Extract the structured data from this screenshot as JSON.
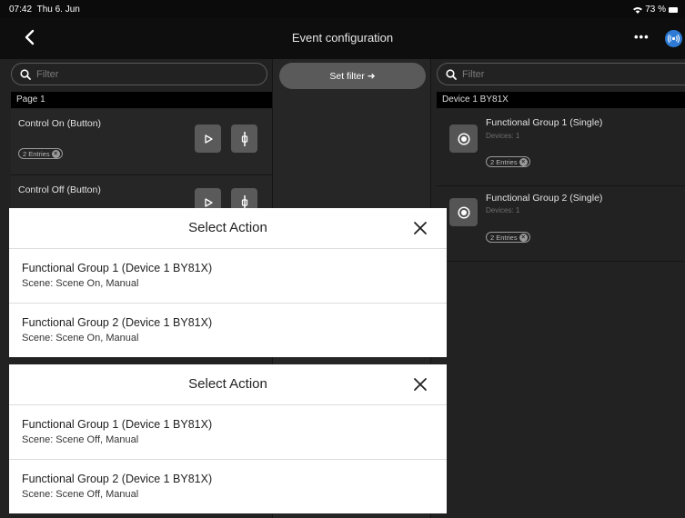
{
  "status": {
    "time": "07:42",
    "date": "Thu 6. Jun",
    "battery": "73 %"
  },
  "nav": {
    "title": "Event configuration",
    "more_label": "•••"
  },
  "left": {
    "filter_placeholder": "Filter",
    "section": "Page 1",
    "events": [
      {
        "title": "Control On (Button)",
        "badge": "2 Entries"
      },
      {
        "title": "Control Off (Button)"
      }
    ]
  },
  "middle": {
    "set_filter_label": "Set filter ➜"
  },
  "right": {
    "filter_placeholder": "Filter",
    "section": "Device 1 BY81X",
    "groups": [
      {
        "title": "Functional Group 1 (Single)",
        "devices": "Devices: 1",
        "badge": "2 Entries"
      },
      {
        "title": "Functional Group 2 (Single)",
        "devices": "Devices: 1",
        "badge": "2 Entries"
      }
    ]
  },
  "modals": [
    {
      "title": "Select Action",
      "items": [
        {
          "title": "Functional Group 1 (Device 1 BY81X)",
          "subtitle": "Scene: Scene On, Manual"
        },
        {
          "title": "Functional Group 2 (Device 1 BY81X)",
          "subtitle": "Scene: Scene On, Manual"
        }
      ]
    },
    {
      "title": "Select Action",
      "items": [
        {
          "title": "Functional Group 1 (Device 1 BY81X)",
          "subtitle": "Scene: Scene Off, Manual"
        },
        {
          "title": "Functional Group 2 (Device 1 BY81X)",
          "subtitle": "Scene: Scene Off, Manual"
        }
      ]
    }
  ],
  "colors": {
    "accent": "#2e7bd6",
    "background": "#1f1f1f",
    "button": "#5a5a5a"
  }
}
